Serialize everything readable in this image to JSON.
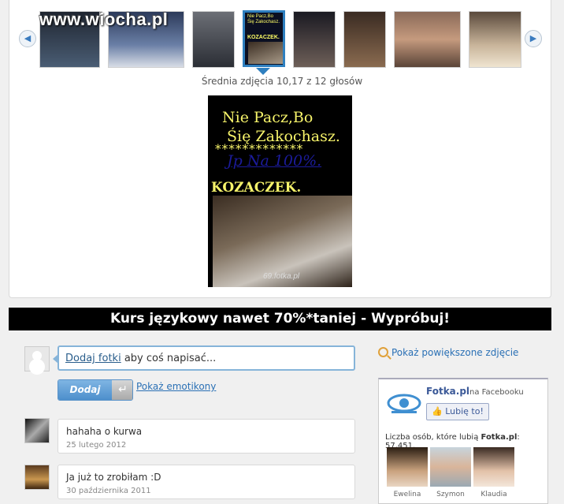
{
  "watermark": "www.wiocha.pl",
  "gallery": {
    "prev_arrow": "◀",
    "next_arrow": "▶",
    "rating_text": "Średnia zdjęcia 10,17 z 12 głosów",
    "thumbs": [
      {
        "name": "thumb-1",
        "color": "#2f3a4b"
      },
      {
        "name": "thumb-2",
        "color": "#3d4a66"
      },
      {
        "name": "thumb-3",
        "color": "#3f4450"
      },
      {
        "name": "thumb-4-active",
        "color": "#1c2a3c"
      },
      {
        "name": "thumb-5",
        "color": "#2d2d35"
      },
      {
        "name": "thumb-6",
        "color": "#4a3a2d"
      },
      {
        "name": "thumb-7",
        "color": "#7b5b48"
      },
      {
        "name": "thumb-8",
        "color": "#5c4a3d"
      }
    ]
  },
  "photo": {
    "line1": "Nie Pacz,Bo\n Śię Zakochasz.",
    "stars": "*************",
    "link": "Jp Na 100%.",
    "kozaczek": "KOZACZEK.",
    "footer": "69.fotka.pl"
  },
  "banner": "Kurs językowy nawet 70%*taniej - Wypróbuj!",
  "compose": {
    "link": "Dodaj fotki",
    "rest": " aby coś napisać...",
    "button": "Dodaj",
    "return_icon": "↵",
    "emoticons": "Pokaż emotikony"
  },
  "comments": [
    {
      "text": "hahaha o kurwa",
      "date": "25 lutego 2012"
    },
    {
      "text": "Ja już to zrobiłam :D",
      "date": "30 października 2011"
    }
  ],
  "sidebar": {
    "zoom_label": "Pokaż powiększone zdjęcie",
    "fb": {
      "page": "Fotka.pl",
      "suffix": "na Facebooku",
      "like": "Lubię to!",
      "count_prefix": "Liczba osób, które lubią ",
      "count_brand": "Fotka.pl",
      "count_value": ": 57,451.",
      "fans": [
        "Ewelina",
        "Szymon",
        "Klaudia"
      ]
    }
  }
}
